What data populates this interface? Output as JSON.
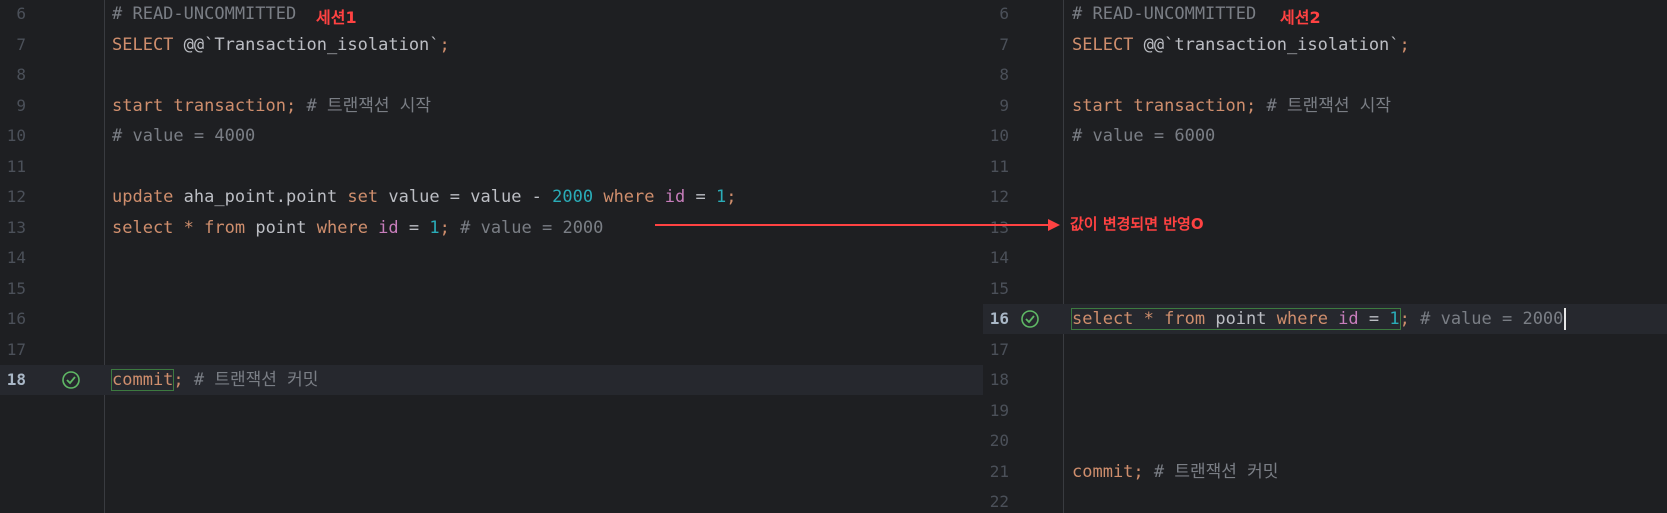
{
  "left_editor": {
    "lines": [
      {
        "no": "6",
        "segments": [
          {
            "t": "# READ-UNCOMMITTED ",
            "c": "cm"
          }
        ]
      },
      {
        "no": "7",
        "segments": [
          {
            "t": "SELECT ",
            "c": "kw"
          },
          {
            "t": "@@`Transaction_isolation`",
            "c": "id"
          },
          {
            "t": ";",
            "c": "kw"
          }
        ]
      },
      {
        "no": "8",
        "segments": []
      },
      {
        "no": "9",
        "segments": [
          {
            "t": "start transaction; ",
            "c": "kw"
          },
          {
            "t": "# 트랜잭션 시작",
            "c": "cm"
          }
        ]
      },
      {
        "no": "10",
        "segments": [
          {
            "t": "# value = 4000",
            "c": "cm"
          }
        ]
      },
      {
        "no": "11",
        "segments": []
      },
      {
        "no": "12",
        "segments": [
          {
            "t": "update ",
            "c": "kw"
          },
          {
            "t": "aha_point.point ",
            "c": "id"
          },
          {
            "t": "set ",
            "c": "kw"
          },
          {
            "t": "value = value - ",
            "c": "id"
          },
          {
            "t": "2000 ",
            "c": "num"
          },
          {
            "t": "where ",
            "c": "kw"
          },
          {
            "t": "id",
            "c": "fld"
          },
          {
            "t": " = ",
            "c": "id"
          },
          {
            "t": "1",
            "c": "num"
          },
          {
            "t": ";",
            "c": "kw"
          }
        ]
      },
      {
        "no": "13",
        "segments": [
          {
            "t": "select ",
            "c": "kw"
          },
          {
            "t": "* ",
            "c": "kw"
          },
          {
            "t": "from ",
            "c": "kw"
          },
          {
            "t": "point ",
            "c": "id"
          },
          {
            "t": "where ",
            "c": "kw"
          },
          {
            "t": "id",
            "c": "fld"
          },
          {
            "t": " = ",
            "c": "id"
          },
          {
            "t": "1",
            "c": "num"
          },
          {
            "t": "; ",
            "c": "kw"
          },
          {
            "t": "# value = 2000",
            "c": "cm"
          }
        ]
      },
      {
        "no": "14",
        "segments": []
      },
      {
        "no": "15",
        "segments": []
      },
      {
        "no": "16",
        "segments": []
      },
      {
        "no": "17",
        "segments": []
      },
      {
        "no": "18",
        "active": true,
        "check": true,
        "segments": [
          {
            "t": "commit",
            "c": "kw",
            "box": true
          },
          {
            "t": "; ",
            "c": "kw"
          },
          {
            "t": "# 트랜잭션 커밋",
            "c": "cm"
          }
        ]
      }
    ]
  },
  "right_editor": {
    "lines": [
      {
        "no": "6",
        "segments": [
          {
            "t": "# READ-UNCOMMITTED ",
            "c": "cm"
          }
        ]
      },
      {
        "no": "7",
        "segments": [
          {
            "t": "SELECT ",
            "c": "kw"
          },
          {
            "t": "@@`transaction_isolation`",
            "c": "id"
          },
          {
            "t": ";",
            "c": "kw"
          }
        ]
      },
      {
        "no": "8",
        "segments": []
      },
      {
        "no": "9",
        "segments": [
          {
            "t": "start transaction; ",
            "c": "kw"
          },
          {
            "t": "# 트랜잭션 시작",
            "c": "cm"
          }
        ]
      },
      {
        "no": "10",
        "segments": [
          {
            "t": "# value = 6000",
            "c": "cm"
          }
        ]
      },
      {
        "no": "11",
        "segments": []
      },
      {
        "no": "12",
        "segments": []
      },
      {
        "no": "13",
        "segments": []
      },
      {
        "no": "14",
        "segments": []
      },
      {
        "no": "15",
        "segments": []
      },
      {
        "no": "16",
        "active": true,
        "check": true,
        "caret": true,
        "segments": [
          {
            "t": "select * from point where id = 1",
            "c": "box-group"
          },
          {
            "t": "; ",
            "c": "kw"
          },
          {
            "t": "# value = 2000",
            "c": "cm"
          }
        ]
      },
      {
        "no": "17",
        "segments": []
      },
      {
        "no": "18",
        "segments": []
      },
      {
        "no": "19",
        "segments": []
      },
      {
        "no": "20",
        "segments": []
      },
      {
        "no": "21",
        "segments": [
          {
            "t": "commit; ",
            "c": "kw"
          },
          {
            "t": "# 트랜잭션 커밋",
            "c": "cm"
          }
        ]
      },
      {
        "no": "22",
        "segments": []
      }
    ]
  },
  "annotations": {
    "session1": "세션1",
    "session2": "세션2",
    "arrow_note": "값이 변경되면 반영O"
  },
  "colors": {
    "background": "#1e1f22",
    "keyword": "#cf8e6d",
    "comment": "#7a7e85",
    "number": "#2aacb8",
    "field": "#c77dbb",
    "annotation": "#ff4242",
    "check": "#5fb865"
  },
  "icons": {
    "run_check": "check-circle-icon"
  }
}
